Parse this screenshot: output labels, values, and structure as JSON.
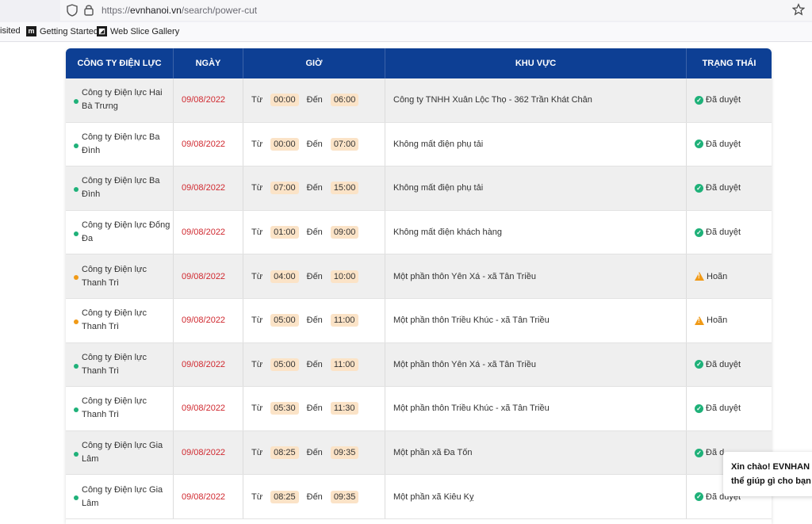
{
  "browser": {
    "url_scheme": "https://",
    "url_host": "evnhanoi.vn",
    "url_path": "/search/power-cut",
    "bookmarks": [
      "isited",
      "Getting Started",
      "Web Slice Gallery"
    ]
  },
  "table": {
    "headers": [
      "CÔNG TY ĐIỆN LỰC",
      "NGÀY",
      "GIỜ",
      "KHU VỰC",
      "TRẠNG THÁI"
    ],
    "from_label": "Từ",
    "to_label": "Đến",
    "rows": [
      {
        "company": "Công ty Điện lực Hai Bà Trưng",
        "date": "09/08/2022",
        "from": "00:00",
        "to": "06:00",
        "area": "Công ty TNHH Xuân Lộc Thọ - 362 Trần Khát Chân",
        "status": "Đã duyệt",
        "state": "ok"
      },
      {
        "company": "Công ty Điện lực Ba Đình",
        "date": "09/08/2022",
        "from": "00:00",
        "to": "07:00",
        "area": "Không mất điện phụ tải",
        "status": "Đã duyệt",
        "state": "ok"
      },
      {
        "company": "Công ty Điện lực Ba Đình",
        "date": "09/08/2022",
        "from": "07:00",
        "to": "15:00",
        "area": "Không mất điện phụ tải",
        "status": "Đã duyệt",
        "state": "ok"
      },
      {
        "company": "Công ty Điện lực Đống Đa",
        "date": "09/08/2022",
        "from": "01:00",
        "to": "09:00",
        "area": "Không mất điện khách hàng",
        "status": "Đã duyệt",
        "state": "ok"
      },
      {
        "company": "Công ty Điện lực Thanh Trì",
        "date": "09/08/2022",
        "from": "04:00",
        "to": "10:00",
        "area": "Một phần thôn Yên Xá - xã Tân Triều",
        "status": "Hoãn",
        "state": "warn"
      },
      {
        "company": "Công ty Điện lực Thanh Trì",
        "date": "09/08/2022",
        "from": "05:00",
        "to": "11:00",
        "area": "Một phần thôn Triều Khúc - xã Tân Triều",
        "status": "Hoãn",
        "state": "warn"
      },
      {
        "company": "Công ty Điện lực Thanh Trì",
        "date": "09/08/2022",
        "from": "05:00",
        "to": "11:00",
        "area": "Một phần thôn Yên Xá - xã Tân Triều",
        "status": "Đã duyệt",
        "state": "ok"
      },
      {
        "company": "Công ty Điện lực Thanh Trì",
        "date": "09/08/2022",
        "from": "05:30",
        "to": "11:30",
        "area": "Một phần thôn Triều Khúc - xã Tân Triều",
        "status": "Đã duyệt",
        "state": "ok"
      },
      {
        "company": "Công ty Điện lực Gia Lâm",
        "date": "09/08/2022",
        "from": "08:25",
        "to": "09:35",
        "area": "Một phần xã Đa Tốn",
        "status": "Đã d",
        "state": "ok"
      },
      {
        "company": "Công ty Điện lực Gia Lâm",
        "date": "09/08/2022",
        "from": "08:25",
        "to": "09:35",
        "area": "Một phần xã Kiêu Kỵ",
        "status": "Đã duyệt",
        "state": "ok"
      }
    ]
  },
  "chat": {
    "line1": "Xin chào! EVNHAN",
    "line2": "thể giúp gì cho bạn"
  },
  "colors": {
    "header_bg": "#0d3f94",
    "date_red": "#d0282f",
    "ok_green": "#1fb179",
    "warn_orange": "#f09a17",
    "chip_bg": "#fbe3c7"
  }
}
